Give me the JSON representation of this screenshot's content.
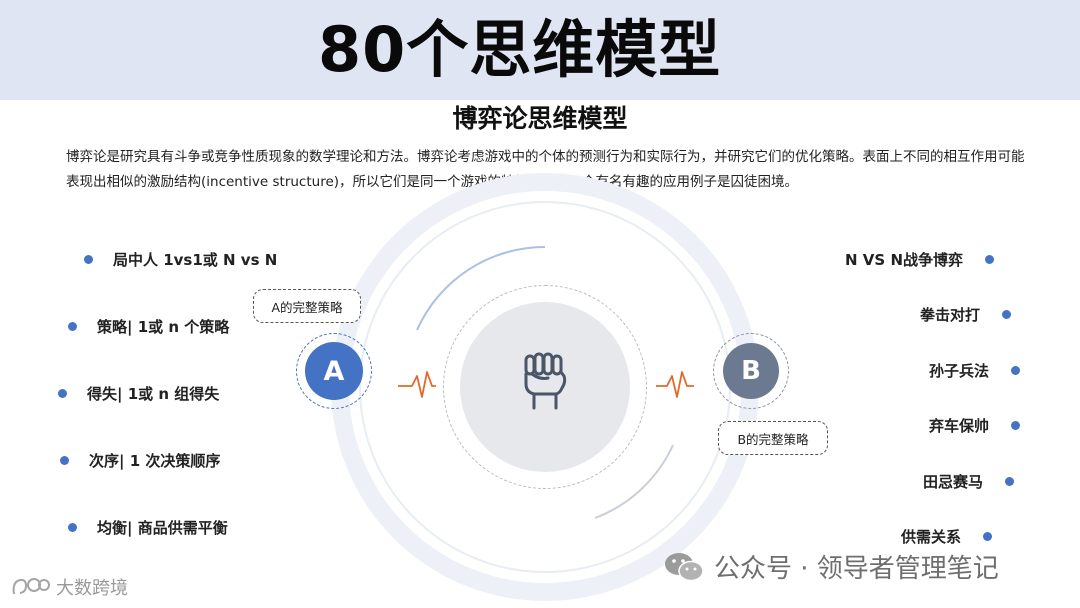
{
  "header": {
    "title": "80个思维模型",
    "subtitle": "博弈论思维模型",
    "description": "博弈论是研究具有斗争或竞争性质现象的数学理论和方法。博弈论考虑游戏中的个体的预测行为和实际行为，并研究它们的优化策略。表面上不同的相互作用可能表现出相似的激励结构(incentive structure)，所以它们是同一个游戏的特例。其中一个有名有趣的应用例子是囚徒困境。"
  },
  "left_items": [
    "局中人 1vs1或 N vs N",
    "策略| 1或 n 个策略",
    "得失| 1或 n 组得失",
    "次序| 1 次决策顺序",
    "均衡| 商品供需平衡"
  ],
  "right_items": [
    "N VS N战争博弈",
    "拳击对打",
    "孙子兵法",
    "弃车保帅",
    "田忌赛马",
    "供需关系"
  ],
  "diagram": {
    "player_a": "A",
    "player_b": "B",
    "label_a": "A的完整策略",
    "label_b": "B的完整策略",
    "center_icon": "fist-icon"
  },
  "watermarks": {
    "right_text": "公众号 · 领导者管理笔记",
    "left_text": "大数跨境"
  },
  "colors": {
    "banner": "#dfe5f2",
    "accent_blue": "#4472c4",
    "b_gray": "#6b7a90",
    "pulse_orange": "#e06a2a"
  }
}
